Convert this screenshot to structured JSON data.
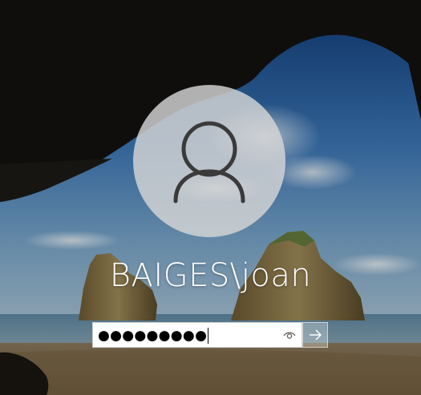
{
  "screen": "Windows sign-in",
  "user": {
    "display_name": "BAIGES\\joan",
    "avatar_icon": "user-silhouette-icon"
  },
  "password_field": {
    "masked_value": "●●●●●●●●●",
    "reveal_icon": "eye-icon"
  },
  "submit": {
    "icon": "arrow-right-icon"
  },
  "colors": {
    "avatar_circle": "#d6d6d6",
    "avatar_glyph": "#3a3a3a",
    "text": "#ffffff",
    "field_bg": "#ffffff"
  }
}
